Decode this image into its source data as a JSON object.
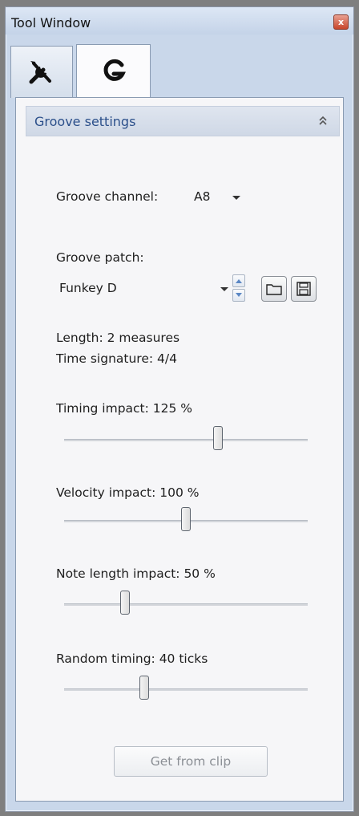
{
  "window": {
    "title": "Tool Window",
    "close_glyph": "x"
  },
  "tabs": [
    {
      "name": "tools-tab",
      "icon": "wrench-screwdriver-icon"
    },
    {
      "name": "groove-tab",
      "icon": "groove-g-icon",
      "selected": true
    }
  ],
  "section": {
    "title": "Groove settings",
    "collapse_icon": "double-chevron-up-icon"
  },
  "groove_channel": {
    "label": "Groove channel:",
    "value": "A8"
  },
  "groove_patch": {
    "label": "Groove patch:",
    "value": "Funkey D"
  },
  "info": {
    "length": "Length: 2 measures",
    "time_signature": "Time signature: 4/4"
  },
  "sliders": [
    {
      "label": "Timing impact: 125 %",
      "fraction": 0.63
    },
    {
      "label": "Velocity impact: 100 %",
      "fraction": 0.5
    },
    {
      "label": "Note length impact: 50 %",
      "fraction": 0.25
    },
    {
      "label": "Random timing: 40 ticks",
      "fraction": 0.33
    }
  ],
  "get_from_clip": {
    "label": "Get from clip",
    "enabled": false
  },
  "colors": {
    "window_bg": "#c9d7ea",
    "section_title": "#2b4f8a",
    "disabled_text": "#8b8f95"
  }
}
